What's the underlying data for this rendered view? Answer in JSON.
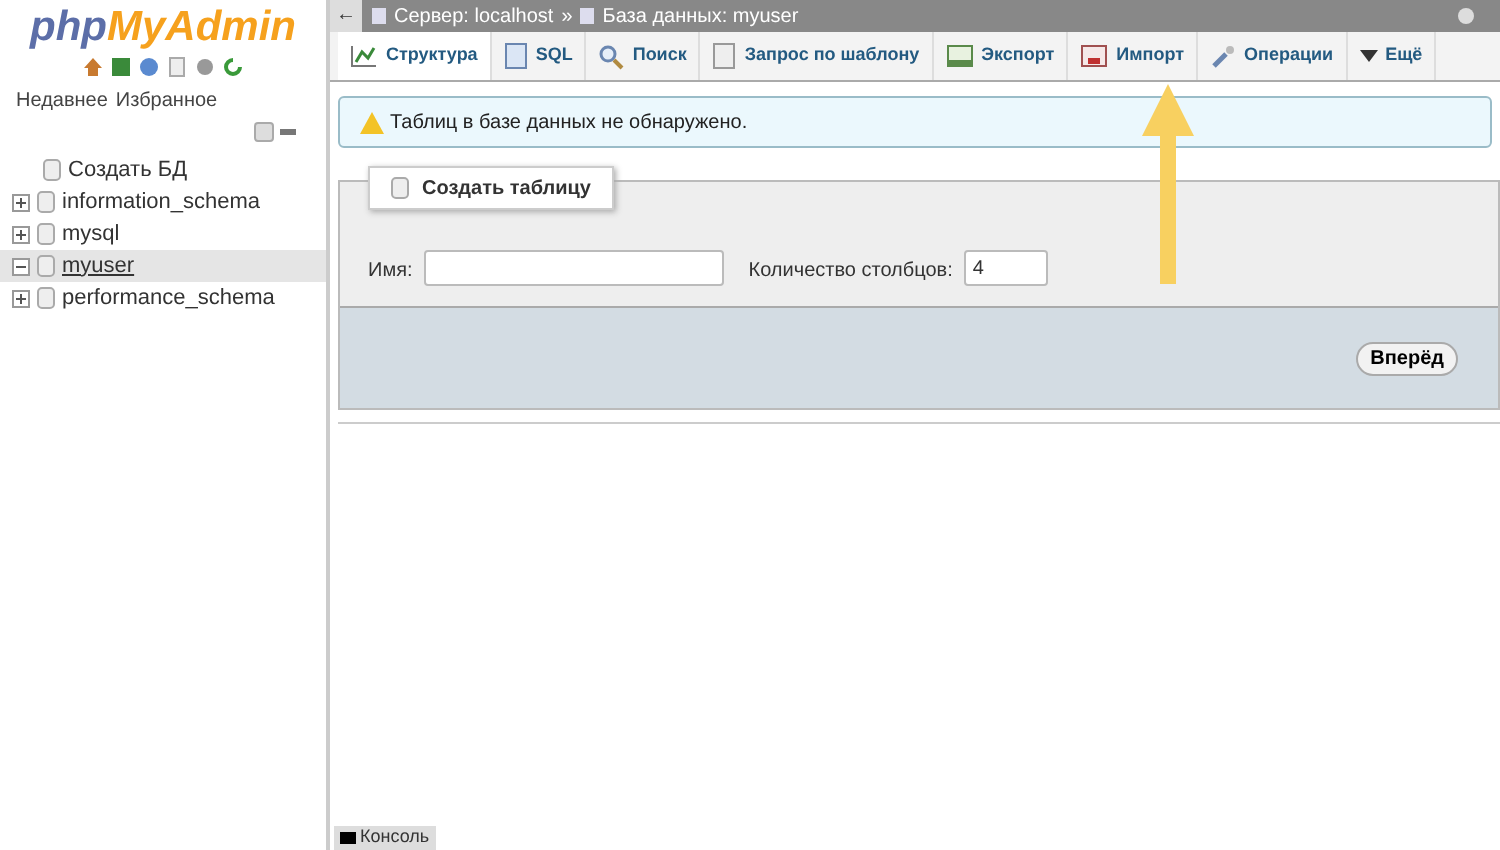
{
  "logo": {
    "php": "php",
    "myadmin": "MyAdmin"
  },
  "sidebar": {
    "tabs": [
      "Недавнее",
      "Избранное"
    ],
    "tree": [
      {
        "label": "Создать БД",
        "kind": "new",
        "selected": false
      },
      {
        "label": "information_schema",
        "kind": "db",
        "expanded": false,
        "selected": false
      },
      {
        "label": "mysql",
        "kind": "db",
        "expanded": false,
        "selected": false
      },
      {
        "label": "myuser",
        "kind": "db",
        "expanded": true,
        "selected": true
      },
      {
        "label": "performance_schema",
        "kind": "db",
        "expanded": false,
        "selected": false
      }
    ]
  },
  "breadcrumb": {
    "back": "←",
    "items": [
      "Сервер: localhost",
      "База данных: myuser"
    ],
    "separator": "»"
  },
  "tabs": [
    {
      "label": "Структура",
      "selected": true
    },
    {
      "label": "SQL",
      "selected": false
    },
    {
      "label": "Поиск",
      "selected": false
    },
    {
      "label": "Запрос по шаблону",
      "selected": false
    },
    {
      "label": "Экспорт",
      "selected": false
    },
    {
      "label": "Импорт",
      "selected": false
    },
    {
      "label": "Операции",
      "selected": false
    },
    {
      "label": "Ещё",
      "selected": false
    }
  ],
  "notice": "Таблиц в базе данных не обнаружено.",
  "create_table": {
    "legend": "Создать таблицу",
    "name_label": "Имя:",
    "columns_label": "Количество столбцов:",
    "columns_value": "4",
    "button": "Вперёд"
  },
  "console": "Консоль"
}
